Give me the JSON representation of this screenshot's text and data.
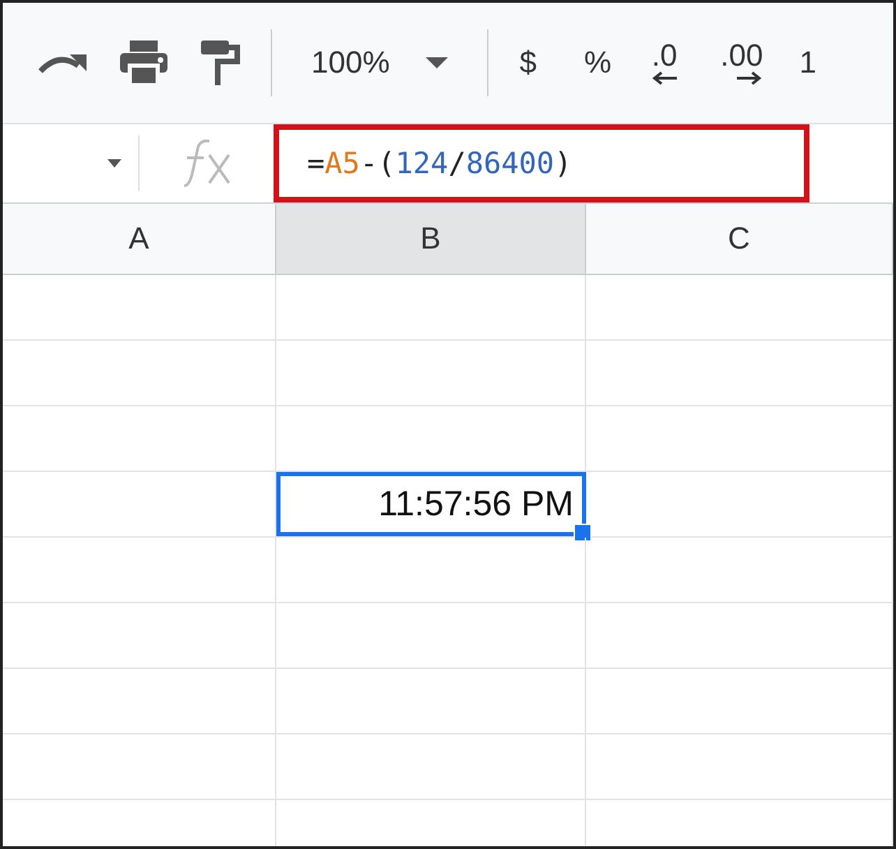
{
  "toolbar": {
    "zoom": "100%",
    "currency": "$",
    "percent": "%",
    "decrease_decimals": ".0",
    "increase_decimals": ".00",
    "more_formats": "1"
  },
  "formula_bar": {
    "highlighted": true,
    "tokens": [
      {
        "kind": "op",
        "text": "="
      },
      {
        "kind": "ref",
        "text": "A5"
      },
      {
        "kind": "op",
        "text": "-("
      },
      {
        "kind": "number",
        "text": "124"
      },
      {
        "kind": "op",
        "text": "/"
      },
      {
        "kind": "number",
        "text": "86400"
      },
      {
        "kind": "op",
        "text": ")"
      }
    ]
  },
  "columns": [
    {
      "label": "A",
      "selected": false
    },
    {
      "label": "B",
      "selected": true
    },
    {
      "label": "C",
      "selected": false
    }
  ],
  "rows": [
    {
      "cells": [
        {
          "selected": false
        },
        {
          "selected": false
        },
        {
          "selected": false
        }
      ]
    },
    {
      "cells": [
        {
          "selected": false
        },
        {
          "selected": false
        },
        {
          "selected": false
        }
      ]
    },
    {
      "cells": [
        {
          "selected": false
        },
        {
          "selected": false
        },
        {
          "selected": false
        }
      ]
    },
    {
      "cells": [
        {
          "selected": false
        },
        {
          "selected": true,
          "value": "11:57:56 PM"
        },
        {
          "selected": false
        }
      ]
    },
    {
      "cells": [
        {
          "selected": false
        },
        {
          "selected": false
        },
        {
          "selected": false
        }
      ]
    },
    {
      "cells": [
        {
          "selected": false
        },
        {
          "selected": false
        },
        {
          "selected": false
        }
      ]
    },
    {
      "cells": [
        {
          "selected": false
        },
        {
          "selected": false
        },
        {
          "selected": false
        }
      ]
    },
    {
      "cells": [
        {
          "selected": false
        },
        {
          "selected": false
        },
        {
          "selected": false
        }
      ]
    },
    {
      "cells": [
        {
          "selected": false
        },
        {
          "selected": false
        },
        {
          "selected": false
        }
      ]
    }
  ]
}
